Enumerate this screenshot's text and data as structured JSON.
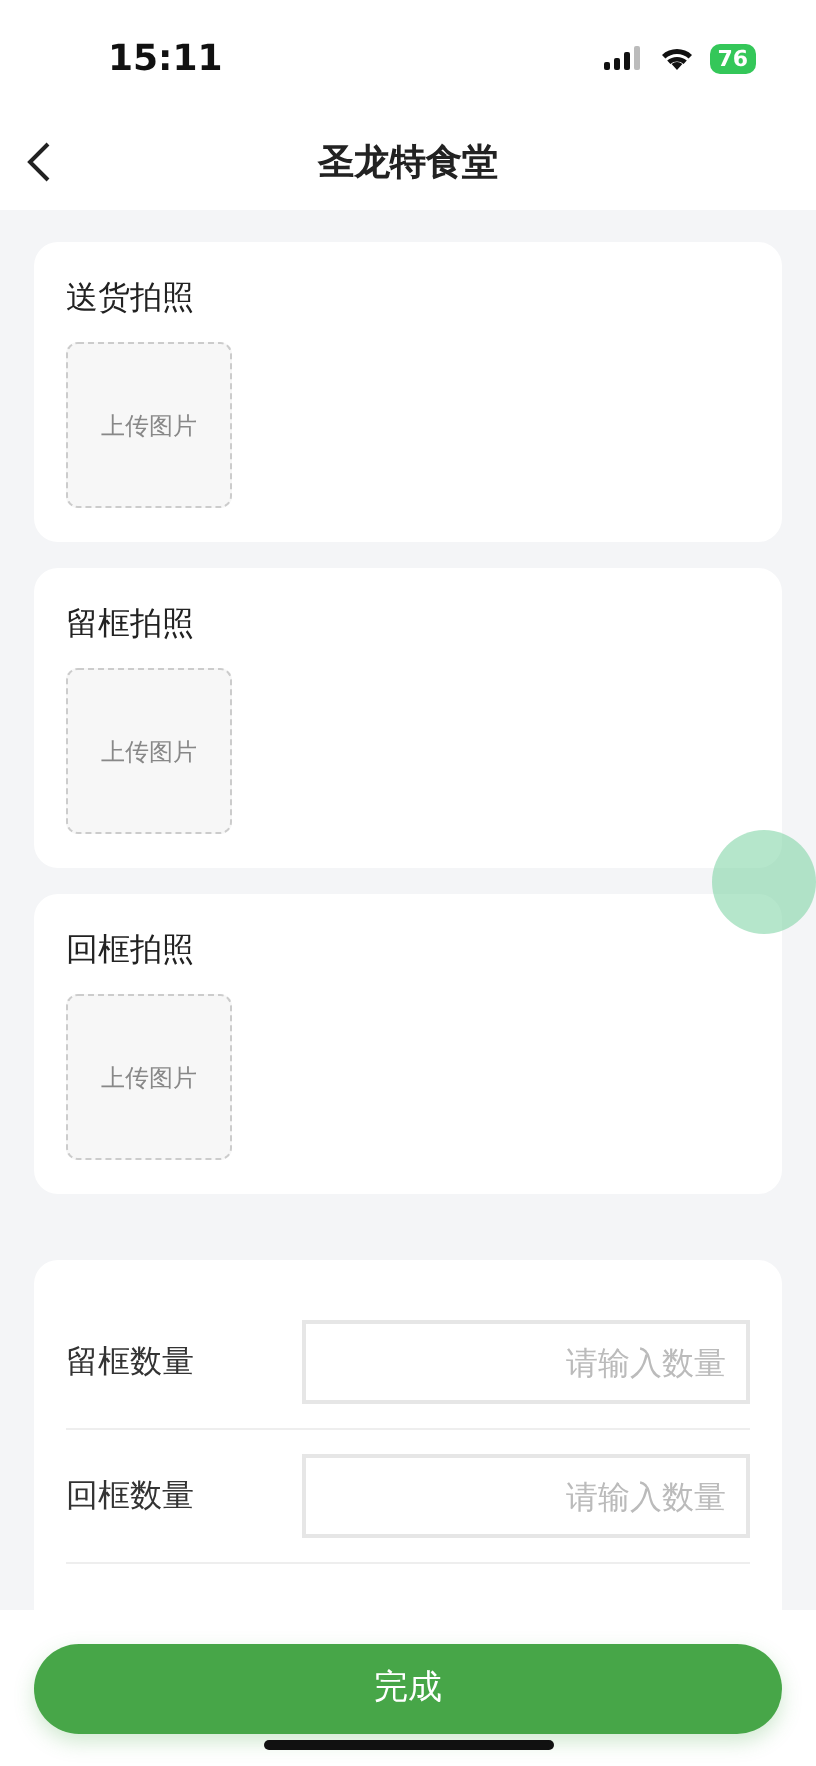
{
  "status_bar": {
    "time": "15:11",
    "battery": "76"
  },
  "header": {
    "title": "圣龙特食堂"
  },
  "photo_sections": [
    {
      "title": "送货拍照",
      "upload_label": "上传图片"
    },
    {
      "title": "留框拍照",
      "upload_label": "上传图片"
    },
    {
      "title": "回框拍照",
      "upload_label": "上传图片"
    }
  ],
  "quantity_fields": [
    {
      "label": "留框数量",
      "placeholder": "请输入数量"
    },
    {
      "label": "回框数量",
      "placeholder": "请输入数量"
    }
  ],
  "footer": {
    "button": "完成"
  }
}
